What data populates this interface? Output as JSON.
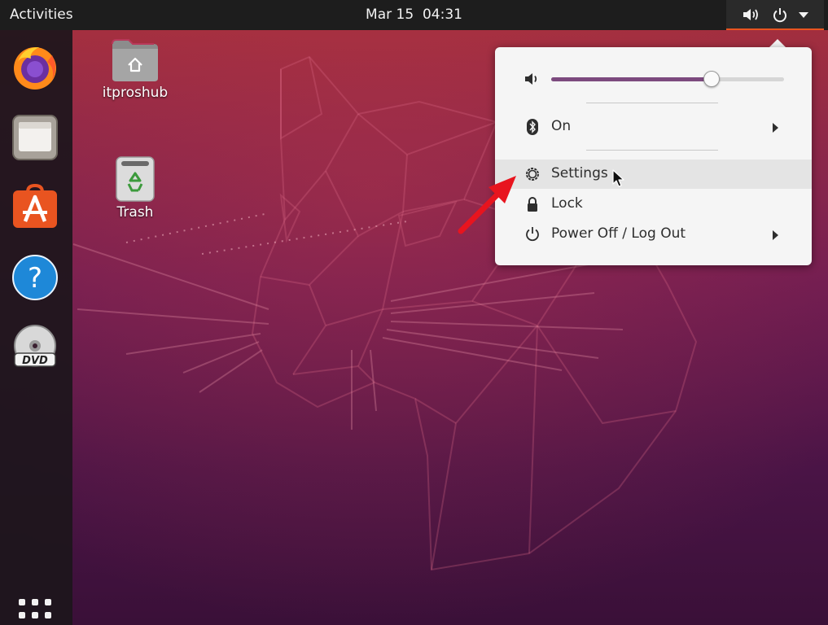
{
  "topbar": {
    "activities_label": "Activities",
    "date": "Mar 15",
    "time": "04:31"
  },
  "dock": {
    "items": [
      {
        "name": "firefox-icon",
        "label": "Firefox"
      },
      {
        "name": "files-icon",
        "label": "Files"
      },
      {
        "name": "software-icon",
        "label": "Ubuntu Software"
      },
      {
        "name": "help-icon",
        "label": "Help"
      },
      {
        "name": "dvd-icon",
        "label": "DVD"
      }
    ],
    "show_apps_icon": "grid-icon"
  },
  "desktop": {
    "icons": [
      {
        "name": "home-folder",
        "label": "itproshub"
      },
      {
        "name": "trash",
        "label": "Trash"
      }
    ]
  },
  "system_menu": {
    "volume_level": 0.69,
    "bluetooth_label": "On",
    "settings_label": "Settings",
    "lock_label": "Lock",
    "power_label": "Power Off / Log Out"
  },
  "colors": {
    "accent": "#e95420",
    "slider_fill": "#7c4a7e",
    "annotation_arrow": "#e8141e",
    "dock_software": "#e95420",
    "dock_help": "#1e88d8"
  }
}
